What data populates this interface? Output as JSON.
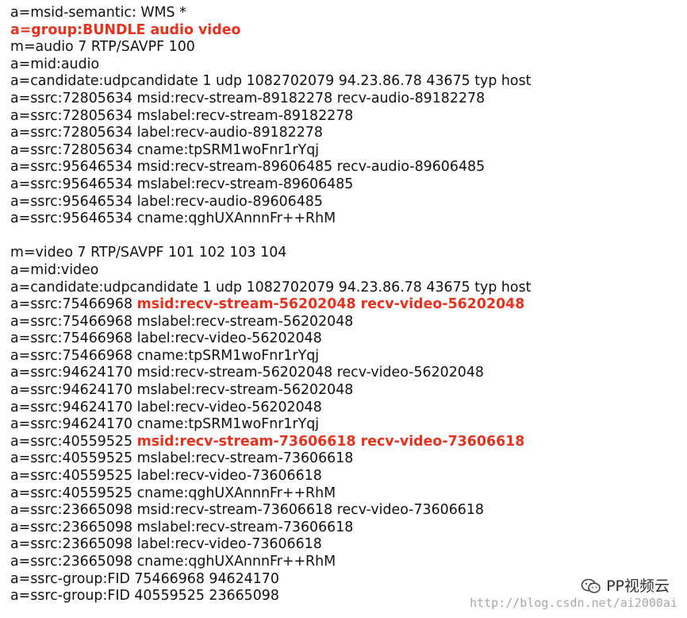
{
  "sdp": {
    "lines": [
      [
        {
          "t": "a=msid-semantic: WMS *"
        }
      ],
      [
        {
          "t": "a=group:BUNDLE audio video",
          "hl": true
        }
      ],
      [
        {
          "t": "m=audio 7 RTP/SAVPF 100"
        }
      ],
      [
        {
          "t": "a=mid:audio"
        }
      ],
      [
        {
          "t": "a=candidate:udpcandidate 1 udp 1082702079 94.23.86.78 43675 typ host"
        }
      ],
      [
        {
          "t": "a=ssrc:72805634 msid:recv-stream-89182278 recv-audio-89182278"
        }
      ],
      [
        {
          "t": "a=ssrc:72805634 mslabel:recv-stream-89182278"
        }
      ],
      [
        {
          "t": "a=ssrc:72805634 label:recv-audio-89182278"
        }
      ],
      [
        {
          "t": "a=ssrc:72805634 cname:tpSRM1woFnr1rYqj"
        }
      ],
      [
        {
          "t": "a=ssrc:95646534 msid:recv-stream-89606485 recv-audio-89606485"
        }
      ],
      [
        {
          "t": "a=ssrc:95646534 mslabel:recv-stream-89606485"
        }
      ],
      [
        {
          "t": "a=ssrc:95646534 label:recv-audio-89606485"
        }
      ],
      [
        {
          "t": "a=ssrc:95646534 cname:qghUXAnnnFr++RhM"
        }
      ],
      [],
      [
        {
          "t": "m=video 7 RTP/SAVPF 101 102 103 104"
        }
      ],
      [
        {
          "t": "a=mid:video"
        }
      ],
      [
        {
          "t": "a=candidate:udpcandidate 1 udp 1082702079 94.23.86.78 43675 typ host"
        }
      ],
      [
        {
          "t": "a=ssrc:75466968 "
        },
        {
          "t": "msid:recv-stream-56202048 recv-video-56202048",
          "hl": true
        }
      ],
      [
        {
          "t": "a=ssrc:75466968 mslabel:recv-stream-56202048"
        }
      ],
      [
        {
          "t": "a=ssrc:75466968 label:recv-video-56202048"
        }
      ],
      [
        {
          "t": "a=ssrc:75466968 cname:tpSRM1woFnr1rYqj"
        }
      ],
      [
        {
          "t": "a=ssrc:94624170 msid:recv-stream-56202048 recv-video-56202048"
        }
      ],
      [
        {
          "t": "a=ssrc:94624170 mslabel:recv-stream-56202048"
        }
      ],
      [
        {
          "t": "a=ssrc:94624170 label:recv-video-56202048"
        }
      ],
      [
        {
          "t": "a=ssrc:94624170 cname:tpSRM1woFnr1rYqj"
        }
      ],
      [
        {
          "t": "a=ssrc:40559525 "
        },
        {
          "t": "msid:recv-stream-73606618 recv-video-73606618",
          "hl": true
        }
      ],
      [
        {
          "t": "a=ssrc:40559525 mslabel:recv-stream-73606618"
        }
      ],
      [
        {
          "t": "a=ssrc:40559525 label:recv-video-73606618"
        }
      ],
      [
        {
          "t": "a=ssrc:40559525 cname:qghUXAnnnFr++RhM"
        }
      ],
      [
        {
          "t": "a=ssrc:23665098 msid:recv-stream-73606618 recv-video-73606618"
        }
      ],
      [
        {
          "t": "a=ssrc:23665098 mslabel:recv-stream-73606618"
        }
      ],
      [
        {
          "t": "a=ssrc:23665098 label:recv-video-73606618"
        }
      ],
      [
        {
          "t": "a=ssrc:23665098 cname:qghUXAnnnFr++RhM"
        }
      ],
      [
        {
          "t": "a=ssrc-group:FID 75466968 94624170"
        }
      ],
      [
        {
          "t": "a=ssrc-group:FID 40559525 23665098"
        }
      ]
    ]
  },
  "watermark": {
    "icon": "wechat-icon",
    "label": "PP视频云"
  },
  "csdn": {
    "url": "http://blog.csdn.net/ai2000ai"
  },
  "colors": {
    "text": "#111111",
    "highlight": "#e8321e",
    "watermark": "#2f2f2f",
    "url": "#8a8a8a"
  }
}
